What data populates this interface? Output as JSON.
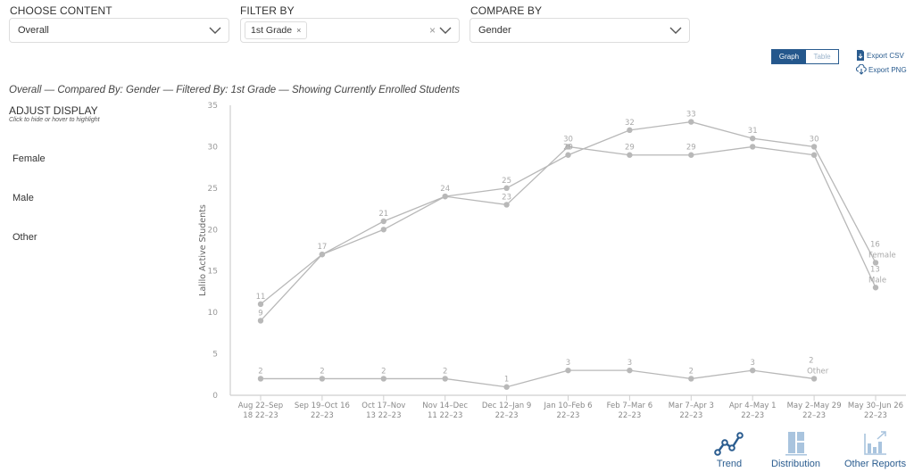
{
  "filters": {
    "choose_content": {
      "label": "CHOOSE CONTENT",
      "value": "Overall"
    },
    "filter_by": {
      "label": "FILTER BY",
      "chips": [
        "1st Grade"
      ],
      "chip_remove": "×",
      "clear": "×"
    },
    "compare_by": {
      "label": "COMPARE BY",
      "value": "Gender"
    }
  },
  "view_toggle": {
    "graph": "Graph",
    "table": "Table",
    "active": "Graph"
  },
  "exports": {
    "csv": "Export CSV",
    "png": "Export PNG"
  },
  "subtitle": "Overall — Compared By: Gender — Filtered By: 1st Grade — Showing Currently Enrolled Students",
  "adjust_display": {
    "title": "ADJUST DISPLAY",
    "hint": "Click to hide or hover to highlight",
    "items": [
      "Female",
      "Male",
      "Other"
    ]
  },
  "bottom_nav": {
    "trend": "Trend",
    "distribution": "Distribution",
    "other_reports": "Other Reports"
  },
  "colors": {
    "accent": "#24578c",
    "series": "#b8b8b8",
    "axis": "#cfcfcf",
    "label": "#a9a9a9"
  },
  "chart_data": {
    "type": "line",
    "title": "",
    "xlabel": "",
    "ylabel": "Lalilo Active Students",
    "ylim": [
      0,
      35
    ],
    "yticks": [
      0,
      5,
      10,
      15,
      20,
      25,
      30,
      35
    ],
    "grid": false,
    "categories": [
      [
        "Aug 22–Sep",
        "18 22–23"
      ],
      [
        "Sep 19–Oct 16",
        "22–23"
      ],
      [
        "Oct 17–Nov",
        "13 22–23"
      ],
      [
        "Nov 14–Dec",
        "11 22–23"
      ],
      [
        "Dec 12–Jan 9",
        "22–23"
      ],
      [
        "Jan 10–Feb 6",
        "22–23"
      ],
      [
        "Feb 7–Mar 6",
        "22–23"
      ],
      [
        "Mar 7–Apr 3",
        "22–23"
      ],
      [
        "Apr 4–May 1",
        "22–23"
      ],
      [
        "May 2–May 29",
        "22–23"
      ],
      [
        "May 30–Jun 26",
        "22–23"
      ]
    ],
    "series": [
      {
        "name": "Female",
        "values": [
          11,
          17,
          21,
          24,
          25,
          29,
          32,
          33,
          31,
          30,
          16
        ]
      },
      {
        "name": "Male",
        "values": [
          9,
          17,
          20,
          24,
          23,
          30,
          29,
          29,
          30,
          29,
          13
        ]
      },
      {
        "name": "Other",
        "values": [
          2,
          2,
          2,
          2,
          1,
          3,
          3,
          2,
          3,
          2,
          null
        ]
      }
    ],
    "data_labels": {
      "Female": [
        11,
        17,
        21,
        24,
        25,
        29,
        32,
        33,
        31,
        30,
        16
      ],
      "Male": [
        9,
        null,
        null,
        null,
        23,
        30,
        29,
        29,
        null,
        null,
        13
      ],
      "Other": [
        2,
        2,
        2,
        2,
        1,
        3,
        3,
        2,
        3,
        2,
        null
      ]
    },
    "end_labels": {
      "Female": "Female",
      "Male": "Male",
      "Other": "Other"
    }
  }
}
